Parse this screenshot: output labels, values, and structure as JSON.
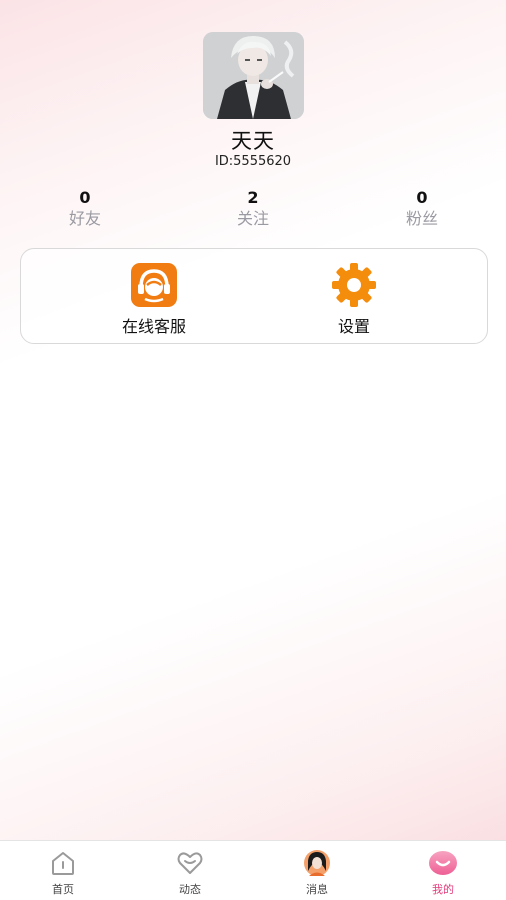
{
  "profile": {
    "avatar_icon": "user-avatar-photo",
    "name": "天天",
    "id_text": "ID:5555620"
  },
  "stats": [
    {
      "value": "0",
      "label": "好友"
    },
    {
      "value": "2",
      "label": "关注"
    },
    {
      "value": "0",
      "label": "粉丝"
    }
  ],
  "actions": {
    "service": {
      "label": "在线客服",
      "icon": "headset-icon",
      "color": "#f07c12"
    },
    "settings": {
      "label": "设置",
      "icon": "gear-icon",
      "color": "#f48c0c"
    }
  },
  "tabbar": {
    "active_color": "#e23c7a",
    "items": [
      {
        "label": "首页",
        "icon": "home-icon"
      },
      {
        "label": "动态",
        "icon": "heart-chat-icon"
      },
      {
        "label": "消息",
        "icon": "message-avatar-icon"
      },
      {
        "label": "我的",
        "icon": "smile-icon"
      }
    ]
  }
}
